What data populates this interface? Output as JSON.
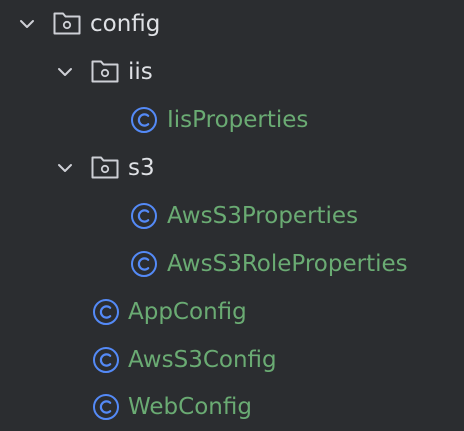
{
  "tree": {
    "config": {
      "label": "config",
      "icon": "folder-icon",
      "expanded": true
    },
    "iis": {
      "label": "iis",
      "icon": "folder-icon",
      "expanded": true,
      "children": [
        {
          "label": "IisProperties",
          "icon": "class-icon"
        }
      ]
    },
    "s3": {
      "label": "s3",
      "icon": "folder-icon",
      "expanded": true,
      "children": [
        {
          "label": "AwsS3Properties",
          "icon": "class-icon"
        },
        {
          "label": "AwsS3RoleProperties",
          "icon": "class-icon"
        }
      ]
    },
    "classes": [
      {
        "label": "AppConfig",
        "icon": "class-icon"
      },
      {
        "label": "AwsS3Config",
        "icon": "class-icon"
      },
      {
        "label": "WebConfig",
        "icon": "class-icon"
      }
    ]
  },
  "colors": {
    "background": "#2b2d30",
    "folder_text": "#dfe1e5",
    "class_text": "#6aab73",
    "class_icon": "#548af7",
    "folder_icon": "#ced0d6",
    "chevron": "#ced0d6"
  }
}
